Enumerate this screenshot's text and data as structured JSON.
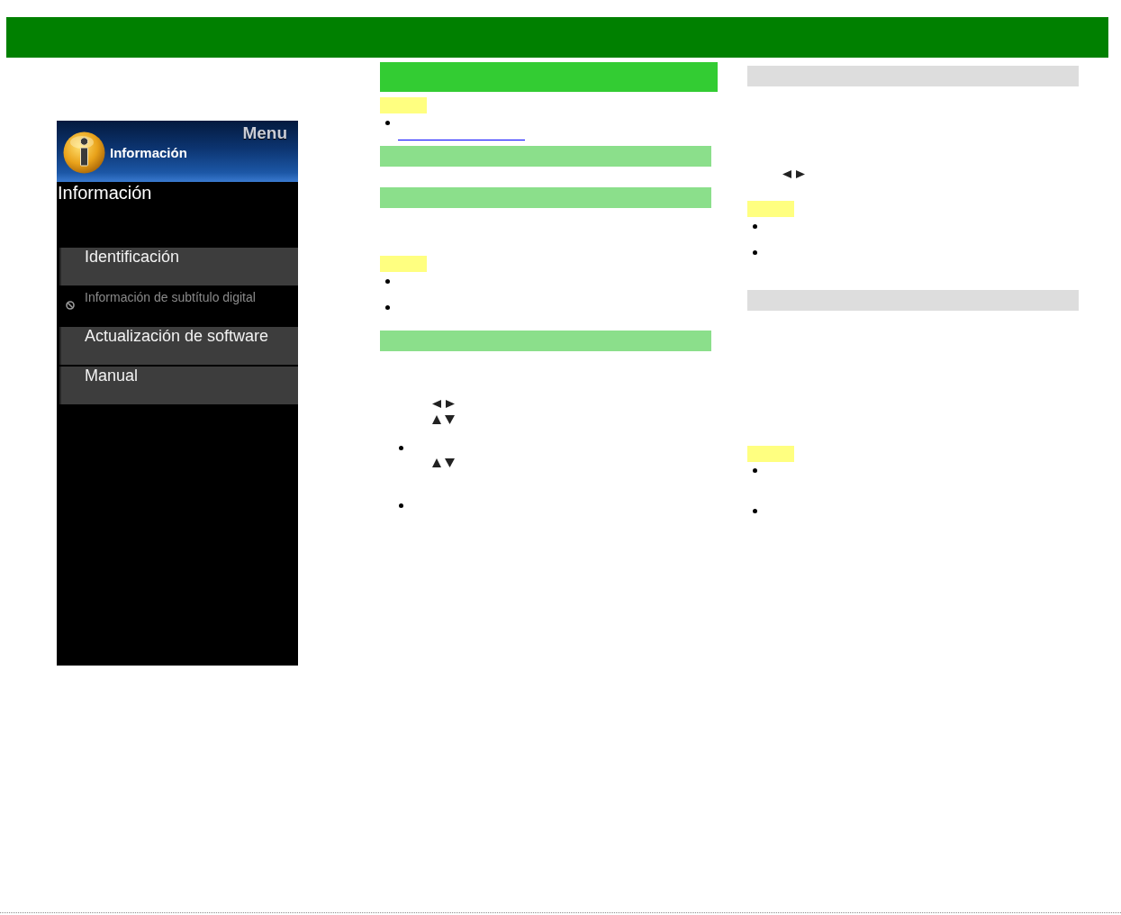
{
  "menu_screen": {
    "title": "Menu",
    "header": "Información",
    "heading": "Información",
    "items": [
      {
        "label": "Identificación",
        "disabled": false
      },
      {
        "label": "Información de subtítulo digital",
        "disabled": true
      },
      {
        "label": "Actualización de software",
        "disabled": false
      },
      {
        "label": "Manual",
        "disabled": false
      }
    ]
  },
  "middle_column": [
    {
      "kind": "title-bar"
    },
    {
      "kind": "note-tag"
    },
    {
      "kind": "bullet"
    },
    {
      "kind": "link"
    },
    {
      "kind": "section-bar"
    },
    {
      "kind": "section-bar"
    },
    {
      "kind": "note-tag"
    },
    {
      "kind": "bullet"
    },
    {
      "kind": "bullet"
    },
    {
      "kind": "section-bar"
    },
    {
      "kind": "left-right-arrows"
    },
    {
      "kind": "up-down-arrows"
    },
    {
      "kind": "sub-bullet"
    },
    {
      "kind": "up-down-arrows"
    },
    {
      "kind": "sub-bullet"
    }
  ],
  "right_column": [
    {
      "kind": "subsection-bar"
    },
    {
      "kind": "left-right-arrows"
    },
    {
      "kind": "note-tag"
    },
    {
      "kind": "bullet"
    },
    {
      "kind": "bullet"
    },
    {
      "kind": "subsection-bar"
    },
    {
      "kind": "note-tag"
    },
    {
      "kind": "bullet"
    },
    {
      "kind": "bullet"
    }
  ]
}
